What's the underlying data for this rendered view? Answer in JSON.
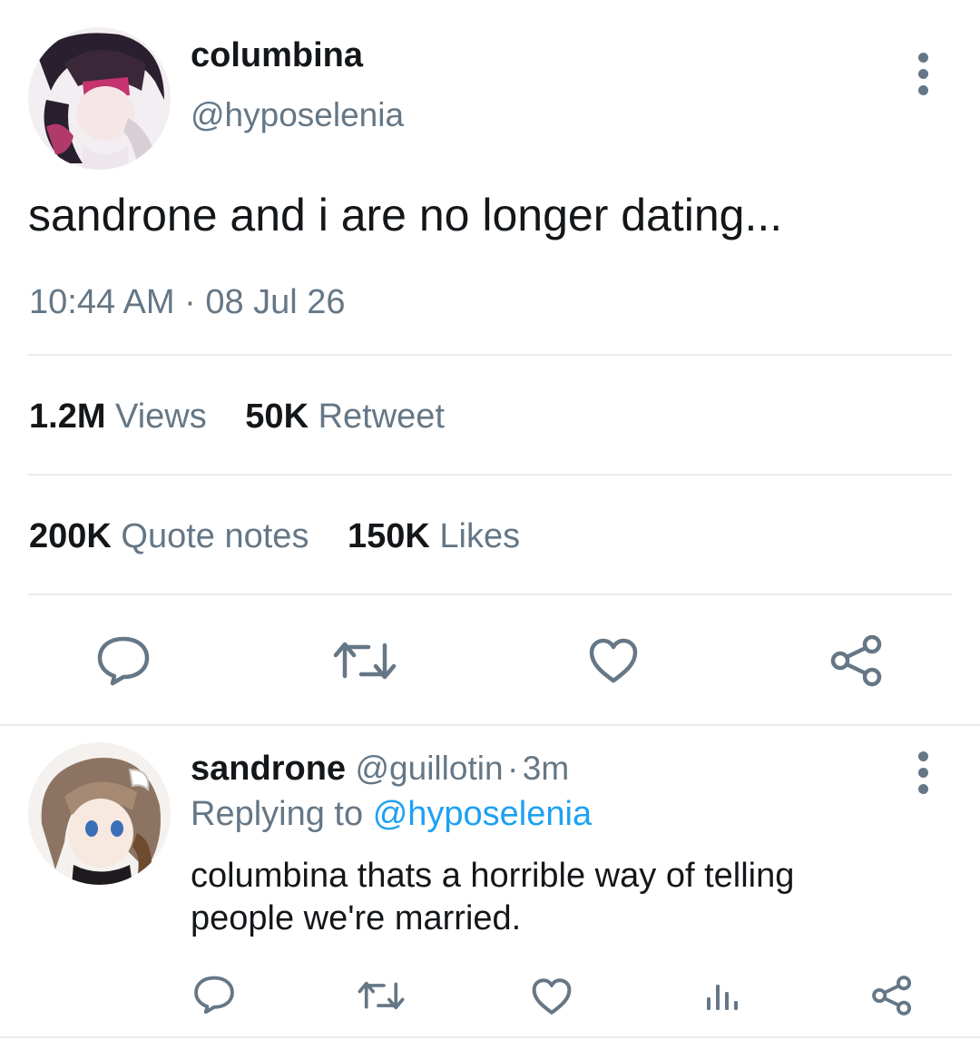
{
  "tweet": {
    "author_name": "columbina",
    "author_handle": "@hyposelenia",
    "text": "sandrone and i are no longer dating...",
    "time": "10:44 AM",
    "separator": "·",
    "date": "08 Jul 26",
    "stats_row1": [
      {
        "value": "1.2M",
        "label": "Views"
      },
      {
        "value": "50K",
        "label": "Retweet"
      }
    ],
    "stats_row2": [
      {
        "value": "200K",
        "label": "Quote notes"
      },
      {
        "value": "150K",
        "label": "Likes"
      }
    ],
    "actions": [
      "reply-icon",
      "retweet-icon",
      "like-icon",
      "share-icon"
    ],
    "more_icon": "more-vertical-icon"
  },
  "reply": {
    "author_name": "sandrone",
    "author_handle": "@guillotin",
    "time_ago": "3m",
    "separator": "·",
    "replying_prefix": "Replying to",
    "replying_handle": "@hyposelenia",
    "text_line1": "columbina thats a horrible way of telling",
    "text_line2": "people we're married.",
    "actions": [
      "reply-icon",
      "retweet-icon",
      "like-icon",
      "analytics-icon",
      "share-icon"
    ],
    "more_icon": "more-vertical-icon"
  },
  "colors": {
    "text": "#14171a",
    "secondary": "#657786",
    "link": "#1da1f2",
    "divider": "#e6ecf0"
  }
}
